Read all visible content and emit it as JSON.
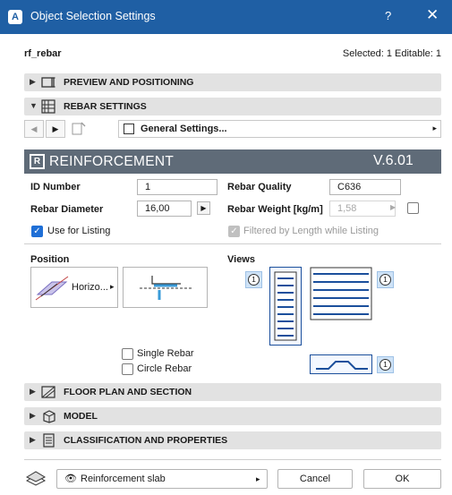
{
  "window": {
    "title": "Object Selection Settings",
    "help": "?",
    "close": "✕",
    "app_icon": "archicad-icon"
  },
  "header": {
    "name": "rf_rebar",
    "status": "Selected: 1 Editable: 1"
  },
  "sections": {
    "preview": {
      "label": "PREVIEW AND POSITIONING",
      "icon": "preview-icon",
      "state": "collapsed"
    },
    "rebar": {
      "label": "REBAR SETTINGS",
      "icon": "rebar-icon",
      "state": "expanded"
    },
    "floor": {
      "label": "FLOOR PLAN AND SECTION",
      "icon": "floor-plan-icon",
      "state": "collapsed"
    },
    "model": {
      "label": "MODEL",
      "icon": "model-icon",
      "state": "collapsed"
    },
    "classification": {
      "label": "CLASSIFICATION AND PROPERTIES",
      "icon": "classification-icon",
      "state": "collapsed"
    }
  },
  "nav": {
    "page": "General Settings...",
    "prev": "◀",
    "next": "▶",
    "arrow": "▸"
  },
  "banner": {
    "logo": "R",
    "title": "REINFORCEMENT",
    "version": "V.6.01"
  },
  "fields": {
    "id_label": "ID Number",
    "id_value": "1",
    "diam_label": "Rebar Diameter",
    "diam_value": "16,00",
    "quality_label": "Rebar Quality",
    "quality_value": "C636",
    "weight_label": "Rebar Weight [kg/m]",
    "weight_value": "1,58",
    "use_listing": "Use for Listing",
    "use_listing_checked": true,
    "filtered": "Filtered by Length while Listing",
    "filtered_checked": true
  },
  "position": {
    "heading": "Position",
    "mode": "Horizo...",
    "arrow": "▸"
  },
  "views": {
    "heading": "Views",
    "chip": "1"
  },
  "options": {
    "single": "Single Rebar",
    "circle": "Circle Rebar"
  },
  "footer": {
    "layer": "Reinforcement slab",
    "layer_arrow": "▸",
    "cancel": "Cancel",
    "ok": "OK"
  },
  "colors": {
    "titlebar": "#1f5fa4",
    "banner": "#5f6b78",
    "section": "#e2e2e2",
    "accent": "#1f6fd6"
  }
}
